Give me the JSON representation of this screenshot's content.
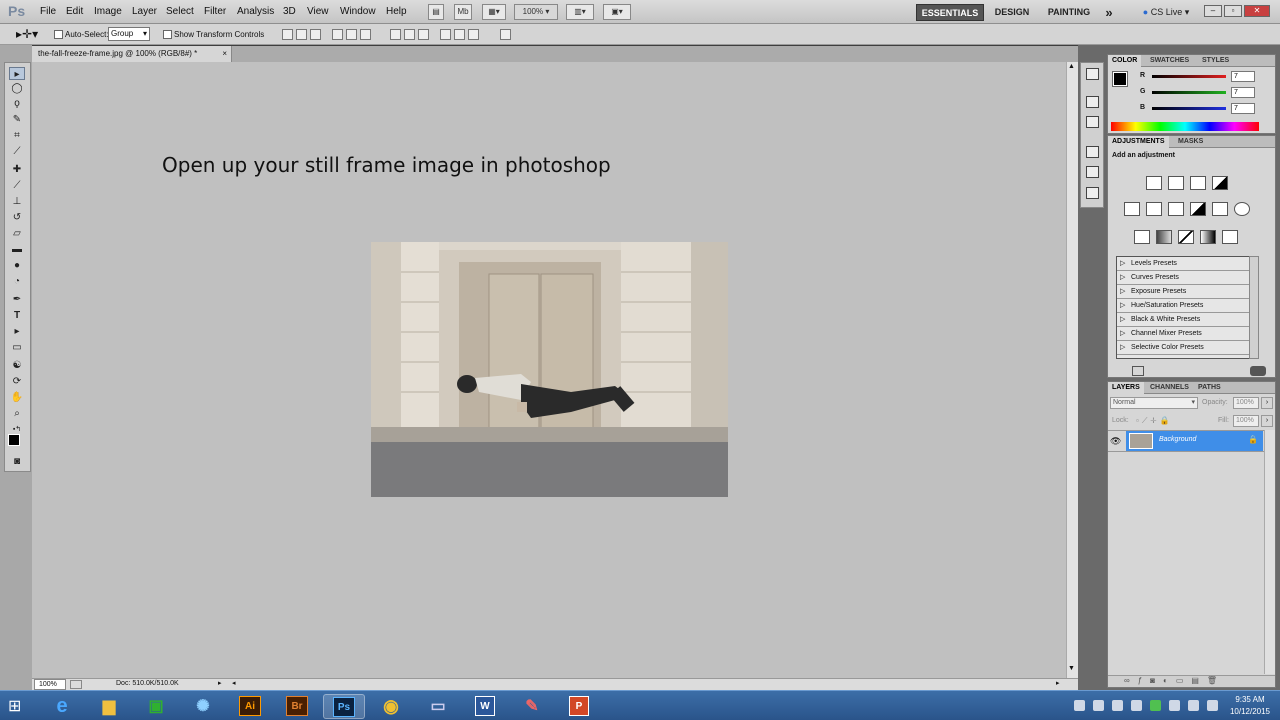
{
  "app": {
    "logo": "Ps"
  },
  "menu": [
    "File",
    "Edit",
    "Image",
    "Layer",
    "Select",
    "Filter",
    "Analysis",
    "3D",
    "View",
    "Window",
    "Help"
  ],
  "menubar_controls": {
    "zoom": "100%",
    "mb_label": "Mb"
  },
  "workspaces": {
    "essentials": "ESSENTIALS",
    "design": "DESIGN",
    "painting": "PAINTING",
    "more": "»",
    "cs_live": "CS Live"
  },
  "options": {
    "auto_select_label": "Auto-Select:",
    "auto_select_value": "Group",
    "show_transform_label": "Show Transform Controls"
  },
  "document": {
    "tab_title": "the-fall-freeze-frame.jpg @ 100% (RGB/8#) *",
    "close": "×"
  },
  "instruction": "Open up your still frame image in photoshop",
  "status": {
    "zoom": "100%",
    "doc": "Doc: 510.0K/510.0K"
  },
  "color_panel": {
    "tabs": [
      "COLOR",
      "SWATCHES",
      "STYLES"
    ],
    "channels": [
      {
        "label": "R",
        "value": "7",
        "color": "#e02020"
      },
      {
        "label": "G",
        "value": "7",
        "color": "#20b020"
      },
      {
        "label": "B",
        "value": "7",
        "color": "#2030e0"
      }
    ]
  },
  "adjustments_panel": {
    "tabs": [
      "ADJUSTMENTS",
      "MASKS"
    ],
    "heading": "Add an adjustment",
    "presets": [
      "Levels Presets",
      "Curves Presets",
      "Exposure Presets",
      "Hue/Saturation Presets",
      "Black & White Presets",
      "Channel Mixer Presets",
      "Selective Color Presets"
    ]
  },
  "layers_panel": {
    "tabs": [
      "LAYERS",
      "CHANNELS",
      "PATHS"
    ],
    "blend_mode": "Normal",
    "opacity_label": "Opacity:",
    "opacity_value": "100%",
    "lock_label": "Lock:",
    "fill_label": "Fill:",
    "fill_value": "100%",
    "layers": [
      {
        "name": "Background",
        "selected": true
      }
    ]
  },
  "taskbar": {
    "apps": [
      "Internet Explorer",
      "File Explorer",
      "Store",
      "Photo",
      "Ai",
      "Br",
      "Ps",
      "Chrome",
      "Remote",
      "Word",
      "Paint",
      "PowerPoint"
    ],
    "time": "9:35 AM",
    "date": "10/12/2015"
  }
}
